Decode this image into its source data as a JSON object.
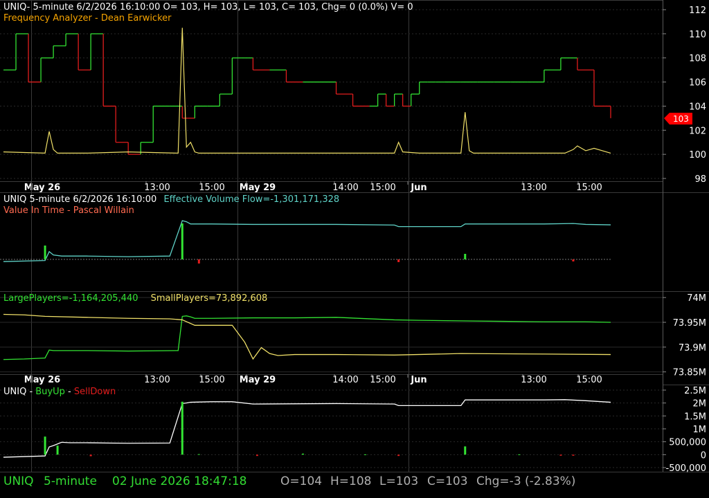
{
  "colors": {
    "background": "#000000",
    "grid": "#2a2a2a",
    "axis_text": "#ffffff",
    "bull": "#33e433",
    "bear": "#e21d1d",
    "yellow": "#f0e068",
    "orange": "#f5a300",
    "cyan": "#5fd3c8",
    "efv_red": "#ff6a50",
    "last_price_tag": "#ff0000",
    "footer_green": "#33dd33",
    "footer_grey": "#b0b0b0"
  },
  "time_axis": {
    "labels": [
      "May 26",
      "13:00",
      "15:00",
      "May 29",
      "14:00",
      "15:00",
      "Jun",
      "13:00",
      "15:00"
    ],
    "bold": [
      true,
      false,
      false,
      true,
      false,
      false,
      true,
      false,
      false
    ]
  },
  "pane1": {
    "header_line": "UNIQ- 5-minute 6/2/2026 16:10:00 O= 103, H= 103, L= 103, C= 103, Chg= 0 (0.0%) V= 0",
    "subtitle": "Frequency Analyzer - Dean Earwicker",
    "y_ticks": [
      "112",
      "110",
      "108",
      "106",
      "104",
      "102",
      "100",
      "98"
    ],
    "last_price_tag": "103"
  },
  "pane2": {
    "title_prefix": "UNIQ 5-minute  6/2/2026 16:10:00",
    "title_indicator": "Effective Volume Flow=-1,301,171,328",
    "subtitle": "Value In Time - Pascal Willain"
  },
  "pane3": {
    "large_label": "LargePlayers=-1,164,205,440",
    "small_label": "SmallPlayers=73,892,608",
    "y_ticks": [
      "74M",
      "73.95M",
      "73.9M",
      "73.85M"
    ]
  },
  "pane4": {
    "title_prefix": "UNIQ - ",
    "buy_label": "BuyUp",
    "sep": "-",
    "sell_label": "SellDown",
    "y_ticks": [
      "2.5M",
      "2M",
      "1.5M",
      "1M",
      "500,000",
      "0",
      "-500,000"
    ]
  },
  "footer": {
    "symbol": "UNIQ",
    "interval": "5-minute",
    "datetime": "02 June 2026 18:47:18",
    "open": "O=104",
    "high": "H=108",
    "low": "L=103",
    "close": "C=103",
    "change": "Chg=-3 (-2.83%)"
  },
  "chart_data": [
    {
      "type": "line",
      "pane": "price",
      "ylim": [
        98,
        112
      ],
      "series": [
        {
          "kind": "step",
          "color": "bull/bear",
          "x": [
            0,
            3,
            6,
            9,
            12,
            15,
            18,
            21,
            24,
            27,
            30,
            33,
            36,
            40,
            43,
            46,
            49,
            52,
            55,
            60,
            64,
            68,
            72,
            76,
            80,
            84,
            88,
            90,
            92,
            94,
            96,
            98,
            100,
            102,
            104,
            106,
            110,
            114,
            118,
            122,
            126,
            130,
            134,
            138,
            142,
            146
          ],
          "y": [
            107,
            110,
            106,
            108,
            109,
            110,
            107,
            110,
            104,
            101,
            100,
            101,
            104,
            104,
            103,
            104,
            104,
            105,
            108,
            107,
            107,
            106,
            106,
            106,
            105,
            104,
            104,
            105,
            104,
            105,
            104,
            105,
            106,
            106,
            106,
            106,
            106,
            106,
            106,
            106,
            106,
            107,
            108,
            107,
            104,
            103
          ]
        },
        {
          "kind": "line",
          "name": "",
          "color": "yellow",
          "x": [
            0,
            10,
            11,
            12,
            13,
            20,
            30,
            42,
            43,
            44,
            45,
            46,
            47,
            50,
            60,
            80,
            94,
            95,
            96,
            100,
            110,
            111,
            112,
            113,
            130,
            135,
            137,
            138,
            140,
            142,
            146
          ],
          "y": [
            100.2,
            100.1,
            101.9,
            100.4,
            100.1,
            100.1,
            100.2,
            100.1,
            110.5,
            100.6,
            101.0,
            100.2,
            100.1,
            100.1,
            100.1,
            100.1,
            100.1,
            101.0,
            100.2,
            100.1,
            100.1,
            103.5,
            100.3,
            100.1,
            100.1,
            100.1,
            100.4,
            100.7,
            100.3,
            100.5,
            100.1
          ]
        }
      ]
    },
    {
      "type": "line",
      "pane": "effective-volume-flow",
      "series": [
        {
          "name": "Effective Volume Flow",
          "color": "cyan",
          "x": [
            0,
            10,
            11,
            12,
            14,
            20,
            30,
            40,
            43,
            44,
            45,
            50,
            60,
            80,
            94,
            95,
            110,
            111,
            130,
            137,
            140,
            146
          ],
          "y": [
            -0.1,
            -0.05,
            0.35,
            0.2,
            0.15,
            0.15,
            0.12,
            0.15,
            1.75,
            1.7,
            1.6,
            1.6,
            1.58,
            1.58,
            1.55,
            1.48,
            1.48,
            1.6,
            1.6,
            1.62,
            1.58,
            1.56
          ]
        }
      ]
    },
    {
      "type": "line",
      "pane": "players",
      "ylim": [
        73.83,
        74.01
      ],
      "series": [
        {
          "name": "LargePlayers",
          "color": "bull",
          "x": [
            0,
            5,
            10,
            11,
            12,
            20,
            30,
            42,
            43,
            44,
            45,
            46,
            50,
            60,
            70,
            80,
            94,
            100,
            110,
            120,
            130,
            140,
            146
          ],
          "y": [
            73.875,
            73.876,
            73.878,
            73.894,
            73.893,
            73.893,
            73.892,
            73.893,
            73.962,
            73.963,
            73.961,
            73.958,
            73.958,
            73.959,
            73.959,
            73.96,
            73.955,
            73.954,
            73.953,
            73.952,
            73.951,
            73.951,
            73.95
          ]
        },
        {
          "name": "SmallPlayers",
          "color": "yellow",
          "x": [
            0,
            5,
            10,
            20,
            30,
            40,
            43,
            46,
            55,
            58,
            60,
            62,
            64,
            66,
            70,
            80,
            94,
            110,
            130,
            146
          ],
          "y": [
            73.966,
            73.965,
            73.962,
            73.96,
            73.958,
            73.957,
            73.955,
            73.944,
            73.944,
            73.91,
            73.876,
            73.899,
            73.887,
            73.883,
            73.885,
            73.885,
            73.884,
            73.887,
            73.886,
            73.885
          ]
        }
      ]
    },
    {
      "type": "line",
      "pane": "buyup-selldown",
      "ylim": [
        -500000,
        2500000
      ],
      "series": [
        {
          "name": "BuyUp-SellDown",
          "color": "white",
          "x": [
            0,
            10,
            11,
            12,
            14,
            16,
            20,
            30,
            40,
            43,
            44,
            45,
            50,
            55,
            60,
            80,
            94,
            95,
            110,
            111,
            130,
            135,
            140,
            146
          ],
          "y": [
            -100000,
            -50000,
            300000,
            350000,
            480000,
            460000,
            460000,
            440000,
            450000,
            1980000,
            2000000,
            2030000,
            2050000,
            2050000,
            1960000,
            1980000,
            1960000,
            1900000,
            1900000,
            2120000,
            2120000,
            2130000,
            2090000,
            2030000
          ]
        },
        {
          "name": "volume",
          "color": "bull/bear",
          "kind": "bars",
          "x": [
            10,
            13,
            21,
            43,
            47,
            61,
            72,
            87,
            95,
            111,
            124,
            134,
            137
          ],
          "y": [
            700000,
            350000,
            -60000,
            2050000,
            20000,
            -50000,
            40000,
            10000,
            -50000,
            320000,
            10000,
            -40000,
            -40000
          ]
        }
      ]
    }
  ]
}
